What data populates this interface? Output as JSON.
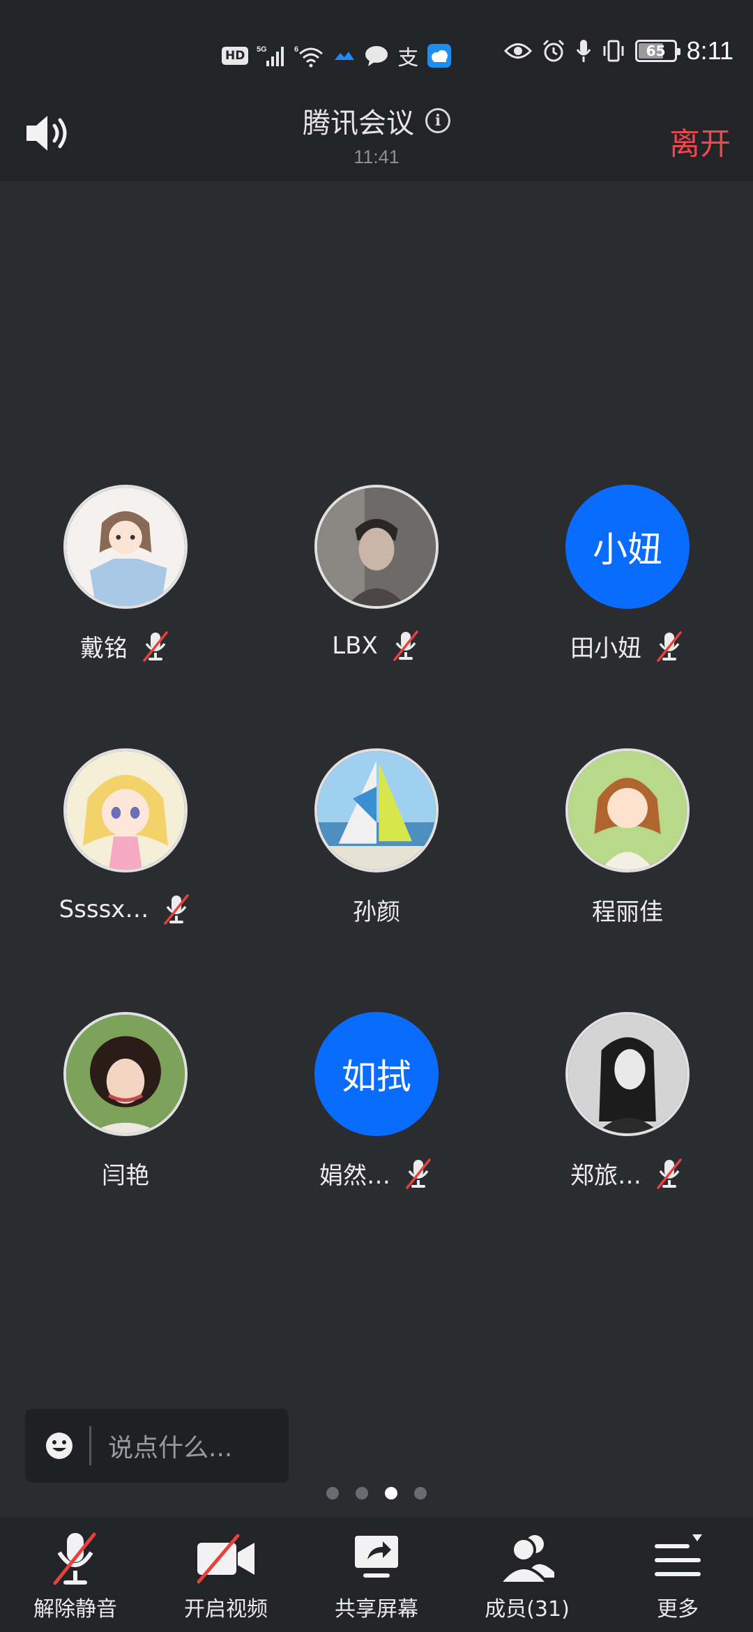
{
  "status_bar": {
    "hd": "HD",
    "net_5g": "5G",
    "wifi_6": "6",
    "alipay": "支",
    "battery": "65",
    "battery_level": 0.65,
    "time": "8:11"
  },
  "header": {
    "title": "腾讯会议",
    "duration": "11:41",
    "leave": "离开"
  },
  "participants": [
    {
      "name": "戴铭",
      "avatar": "photo-anime-girl",
      "muted": true
    },
    {
      "name": "LBX",
      "avatar": "photo-man",
      "muted": true
    },
    {
      "name": "田小妞",
      "avatar_text": "小妞",
      "muted": true
    },
    {
      "name": "Ssssx…",
      "avatar": "photo-cartoon-girl",
      "muted": true
    },
    {
      "name": "孙颜",
      "avatar": "photo-sailboat",
      "muted": false
    },
    {
      "name": "程丽佳",
      "avatar": "photo-anime-woman",
      "muted": false
    },
    {
      "name": "闫艳",
      "avatar": "photo-woman-curly",
      "muted": false
    },
    {
      "name": "娟然…",
      "avatar_text": "如拭",
      "muted": true
    },
    {
      "name": "郑旅…",
      "avatar": "photo-woman-bw",
      "muted": true
    }
  ],
  "chat": {
    "placeholder": "说点什么..."
  },
  "pager": {
    "count": 4,
    "active": 3
  },
  "toolbar": {
    "unmute": "解除静音",
    "start_video": "开启视频",
    "share_screen": "共享屏幕",
    "members": "成员(31)",
    "more": "更多"
  },
  "colors": {
    "background": "#2b2c30",
    "bar": "#232428",
    "accent_blue": "#0a6cff",
    "leave_red": "#f0474d",
    "mute_red": "#e8413d"
  }
}
